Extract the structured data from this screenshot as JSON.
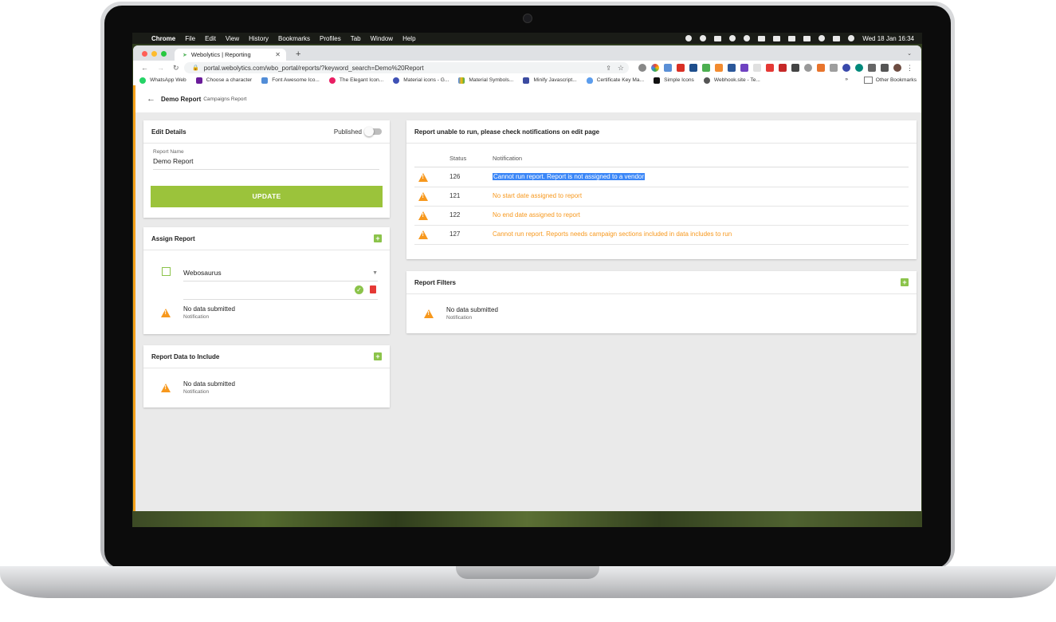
{
  "menubar": {
    "app": "Chrome",
    "items": [
      "File",
      "Edit",
      "View",
      "History",
      "Bookmarks",
      "Profiles",
      "Tab",
      "Window",
      "Help"
    ],
    "datetime": "Wed 18 Jan  16:34"
  },
  "browser": {
    "tab_title": "Webolytics | Reporting",
    "url": "portal.webolytics.com/wbo_portal/reports/?keyword_search=Demo%20Report",
    "bookmarks": [
      "WhatsApp Web",
      "Choose a character",
      "Font Awesome Ico...",
      "The Elegant Icon...",
      "Material icons - G...",
      "Material Symbols...",
      "Minify Javascript...",
      "Certificate Key Ma...",
      "Simple Icons",
      "Webhook.site - Te..."
    ],
    "other_bookmarks": "Other Bookmarks"
  },
  "header": {
    "title": "Demo Report",
    "subtitle": "Campaigns Report"
  },
  "edit_details": {
    "heading": "Edit Details",
    "published_label": "Published",
    "report_name_label": "Report Name",
    "report_name_value": "Demo Report",
    "update_label": "UPDATE"
  },
  "assign_report": {
    "heading": "Assign Report",
    "vendor": "Webosaurus",
    "notice_title": "No data submitted",
    "notice_sub": "Notification"
  },
  "report_data": {
    "heading": "Report Data to Include",
    "notice_title": "No data submitted",
    "notice_sub": "Notification"
  },
  "errors_panel": {
    "heading": "Report unable to run, please check notifications on edit page",
    "col_status": "Status",
    "col_notification": "Notification",
    "rows": [
      {
        "status": "126",
        "message": "Cannot run report. Report is not assigned to a vendor"
      },
      {
        "status": "121",
        "message": "No start date assigned to report"
      },
      {
        "status": "122",
        "message": "No end date assigned to report"
      },
      {
        "status": "127",
        "message": "Cannot run report. Reports needs campaign sections included in data includes to run"
      }
    ]
  },
  "report_filters": {
    "heading": "Report Filters",
    "notice_title": "No data submitted",
    "notice_sub": "Notification"
  },
  "colors": {
    "accent_green": "#9bc33b",
    "warning_orange": "#f7981d",
    "selection_blue": "#3a86f7"
  }
}
